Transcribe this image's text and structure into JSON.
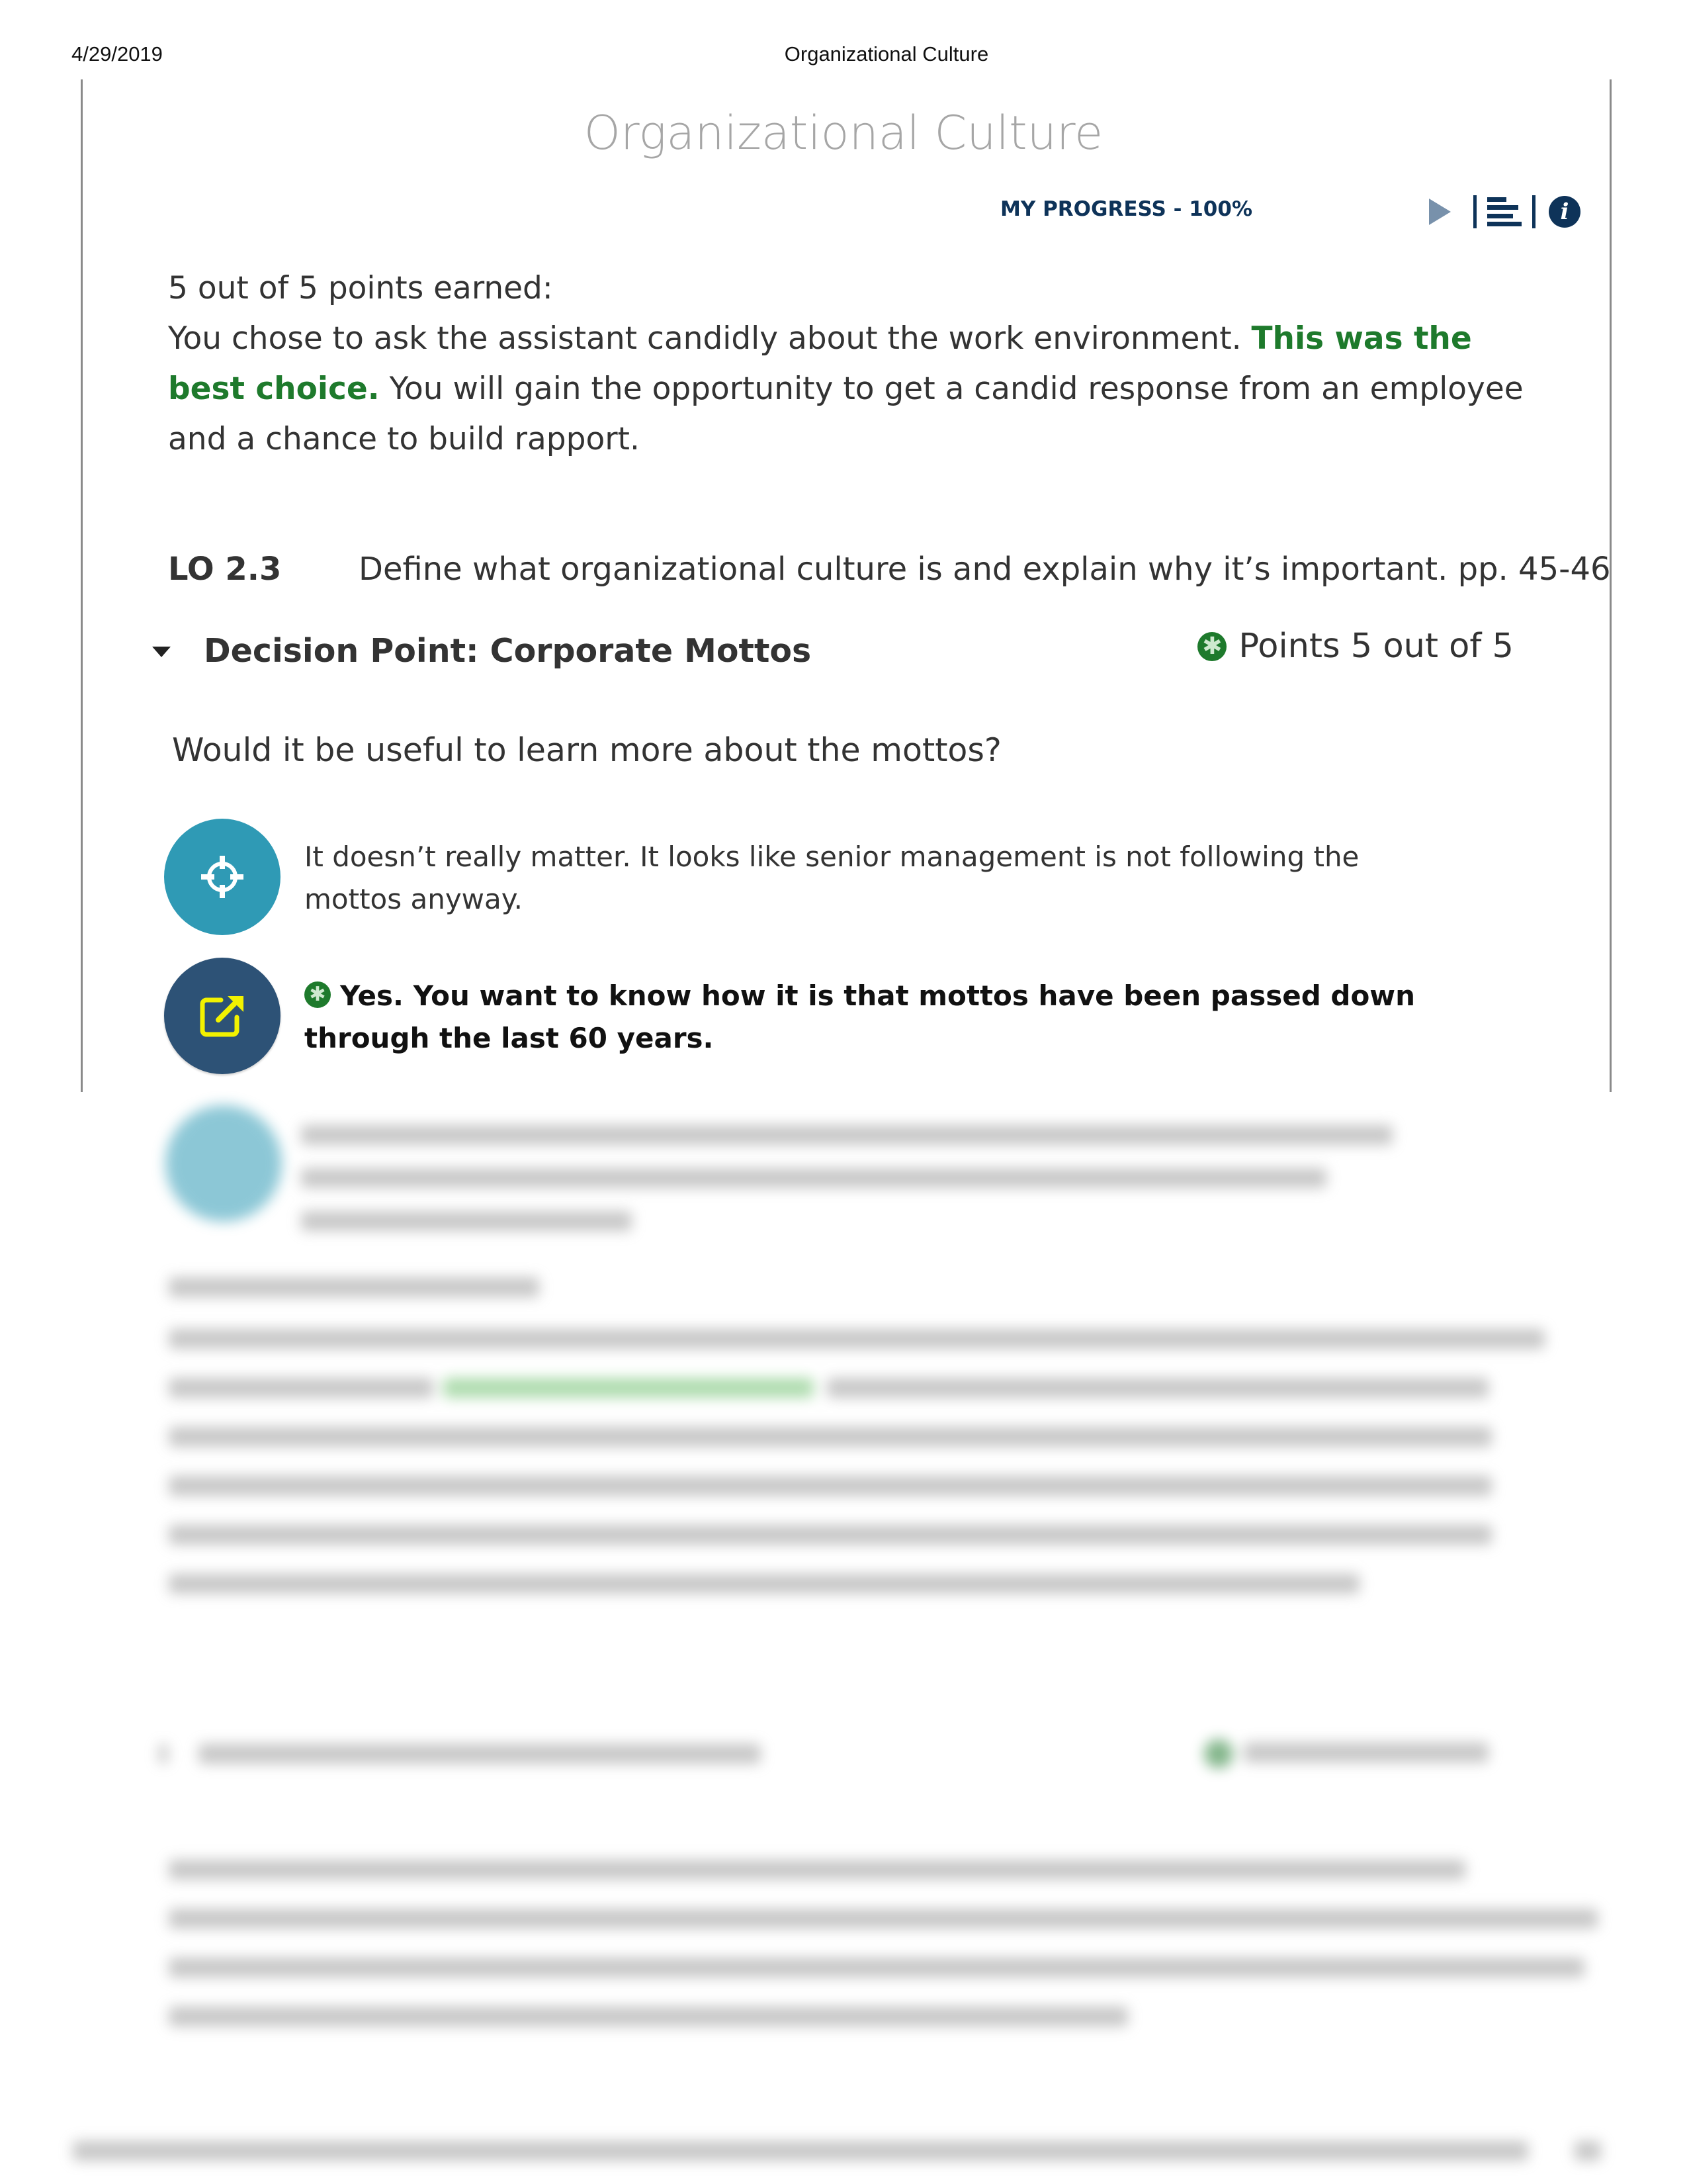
{
  "print_header": {
    "date": "4/29/2019",
    "title": "Organizational Culture"
  },
  "app": {
    "title": "Organizational Culture",
    "progress_label": "MY PROGRESS - 100%",
    "progress_percent": 100,
    "toolbar": {
      "icons": [
        "play-icon",
        "menu-list-icon",
        "info-icon"
      ]
    }
  },
  "feedback": {
    "score_line": "5 out of 5 points earned:",
    "text_before": "You chose to ask the assistant candidly about the work environment. ",
    "highlight": "This was the best choice.",
    "text_after": " You will gain the opportunity to get a candid response from an employee and a chance to build rapport.",
    "highlight_color": "#1e7a2c"
  },
  "learning_objective": {
    "code": "LO 2.3",
    "text": "Define what organizational culture is and explain why it’s important. pp. 45-46"
  },
  "decision_point": {
    "title": "Decision Point: Corporate Mottos",
    "points_label": "Points 5 out of 5",
    "points_earned": 5,
    "points_possible": 5,
    "question": "Would it be useful to learn more about the mottos?",
    "options": [
      {
        "icon": "crosshair-icon",
        "color": "#2f9ab5",
        "text": "It doesn’t really matter. It looks like senior management is not following the mottos anyway.",
        "selected": false
      },
      {
        "icon": "external-link-icon",
        "color": "#2d5276",
        "text": "Yes. You want to know how it is that mottos have been passed down through the last 60 years.",
        "selected": true
      }
    ]
  },
  "colors": {
    "accent_navy": "#0e3359",
    "best_green": "#1e7a2c",
    "option_teal": "#2f9ab5",
    "option_navy": "#2d5276",
    "icon_yellow": "#f2f200"
  }
}
